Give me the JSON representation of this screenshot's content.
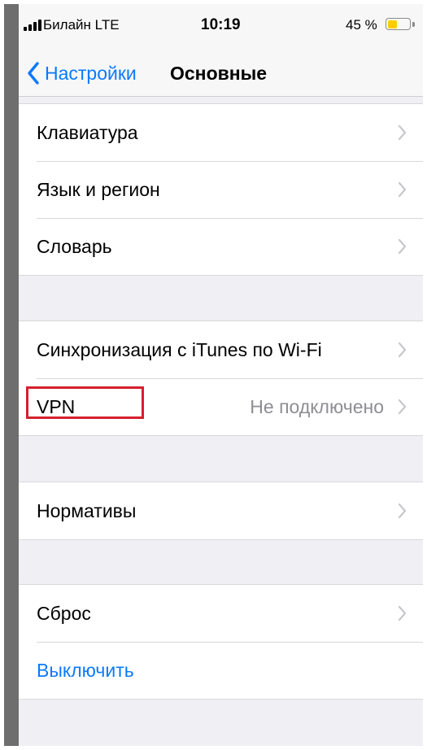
{
  "status_bar": {
    "carrier": "Билайн  LTE",
    "time": "10:19",
    "battery_percent": "45 %",
    "battery_level": 0.45,
    "battery_color": "#ffcc00",
    "signal_bars": 3
  },
  "nav": {
    "back_label": "Настройки",
    "title": "Основные"
  },
  "groups": [
    {
      "rows": [
        {
          "label": "Клавиатура"
        },
        {
          "label": "Язык и регион"
        },
        {
          "label": "Словарь"
        }
      ]
    },
    {
      "rows": [
        {
          "label": "Синхронизация с iTunes по Wi-Fi"
        },
        {
          "label": "VPN",
          "value": "Не подключено",
          "highlighted": true
        }
      ]
    },
    {
      "rows": [
        {
          "label": "Нормативы"
        }
      ]
    },
    {
      "rows": [
        {
          "label": "Сброс"
        },
        {
          "label": "Выключить",
          "style": "action"
        }
      ]
    }
  ],
  "colors": {
    "accent": "#0a7aff",
    "highlight_border": "#d61f2c",
    "secondary_text": "#8e8e93",
    "background": "#efeff4"
  },
  "icons": {
    "back": "chevron-left-icon",
    "disclosure": "chevron-right-icon"
  }
}
